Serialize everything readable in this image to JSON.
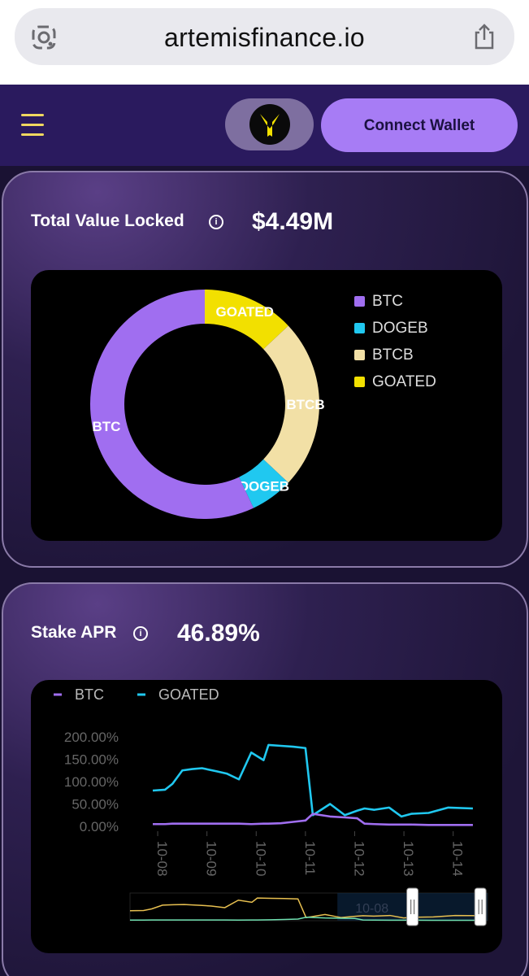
{
  "browser": {
    "url": "artemisfinance.io"
  },
  "header": {
    "connect_label": "Connect Wallet"
  },
  "tvl": {
    "title": "Total Value Locked",
    "value": "$4.49M"
  },
  "apr": {
    "title": "Stake APR",
    "value": "46.89%"
  },
  "colors": {
    "btc": "#a06ef0",
    "dogeb": "#20c8f0",
    "btcb": "#f2e0a6",
    "goated": "#f2e000",
    "brand_purple": "#a77cf5"
  },
  "chart_data": [
    {
      "type": "pie",
      "categories": [
        "BTC",
        "DOGEB",
        "BTCB",
        "GOATED"
      ],
      "values": [
        57,
        6,
        24,
        13
      ],
      "legend": [
        "BTC",
        "DOGEB",
        "BTCB",
        "GOATED"
      ],
      "legend_position": "right"
    },
    {
      "type": "line",
      "legend": [
        "BTC",
        "GOATED"
      ],
      "legend_position": "top-left",
      "x_ticks": [
        "10-08",
        "10-09",
        "10-10",
        "10-11",
        "10-12",
        "10-13",
        "10-14"
      ],
      "y_ticks": [
        "200.00%",
        "150.00%",
        "100.00%",
        "50.00%",
        "0.00%"
      ],
      "ylim": [
        0,
        200
      ],
      "x": [
        0,
        0.25,
        0.4,
        0.6,
        0.8,
        1.0,
        1.3,
        1.5,
        1.75,
        2.0,
        2.25,
        2.35,
        2.6,
        2.85,
        3.1,
        3.25,
        3.6,
        3.9,
        4.15,
        4.3,
        4.5,
        4.8,
        5.05,
        5.25,
        5.6,
        6.0,
        6.5
      ],
      "series": [
        {
          "name": "GOATED",
          "values": [
            80,
            82,
            95,
            125,
            128,
            130,
            123,
            118,
            105,
            165,
            148,
            182,
            180,
            178,
            175,
            25,
            50,
            25,
            35,
            40,
            37,
            42,
            22,
            28,
            30,
            42,
            40
          ]
        },
        {
          "name": "BTC",
          "values": [
            5,
            5,
            6,
            6,
            6,
            6,
            6,
            6,
            6,
            5,
            6,
            6,
            7,
            10,
            13,
            28,
            22,
            20,
            18,
            6,
            5,
            4,
            4,
            4,
            3,
            3,
            3
          ]
        }
      ],
      "range_label": "10-08"
    }
  ]
}
